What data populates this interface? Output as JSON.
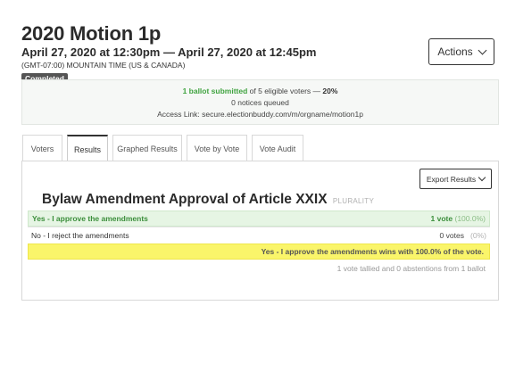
{
  "header": {
    "title": "2020 Motion 1p",
    "date_range": "April 27, 2020 at 12:30pm — April 27, 2020 at 12:45pm",
    "timezone": "(GMT-07:00) MOUNTAIN TIME (US & CANADA)",
    "status": "Completed"
  },
  "actions": {
    "label": "Actions"
  },
  "info": {
    "submitted": "1 ballot submitted",
    "of_text": " of 5 eligible voters — ",
    "percent": "20%",
    "notices": "0 notices queued",
    "access_link": "Access Link: secure.electionbuddy.com/m/orgname/motion1p"
  },
  "tabs": [
    {
      "label": "Voters",
      "active": false
    },
    {
      "label": "Results",
      "active": true
    },
    {
      "label": "Graphed Results",
      "active": false
    },
    {
      "label": "Vote by Vote",
      "active": false
    },
    {
      "label": "Vote Audit",
      "active": false
    }
  ],
  "export": {
    "label": "Export Results"
  },
  "question": {
    "title": "Bylaw Amendment Approval of Article XXIX",
    "method": "PLURALITY"
  },
  "results": [
    {
      "option": "Yes - I approve the amendments",
      "votes": "1 vote",
      "percent": "(100.0%)",
      "winner": true
    },
    {
      "option": "No - I reject the amendments",
      "votes": "0 votes",
      "percent": "(0%)",
      "winner": false
    }
  ],
  "winner_text": "Yes - I approve the amendments wins with 100.0% of the vote.",
  "tally_text": "1 vote tallied and 0 abstentions from 1 ballot",
  "colors": {
    "win_green": "#3fa33f",
    "win_row_bg": "#e6f5e4",
    "winner_bar_bg": "#faf56a"
  }
}
